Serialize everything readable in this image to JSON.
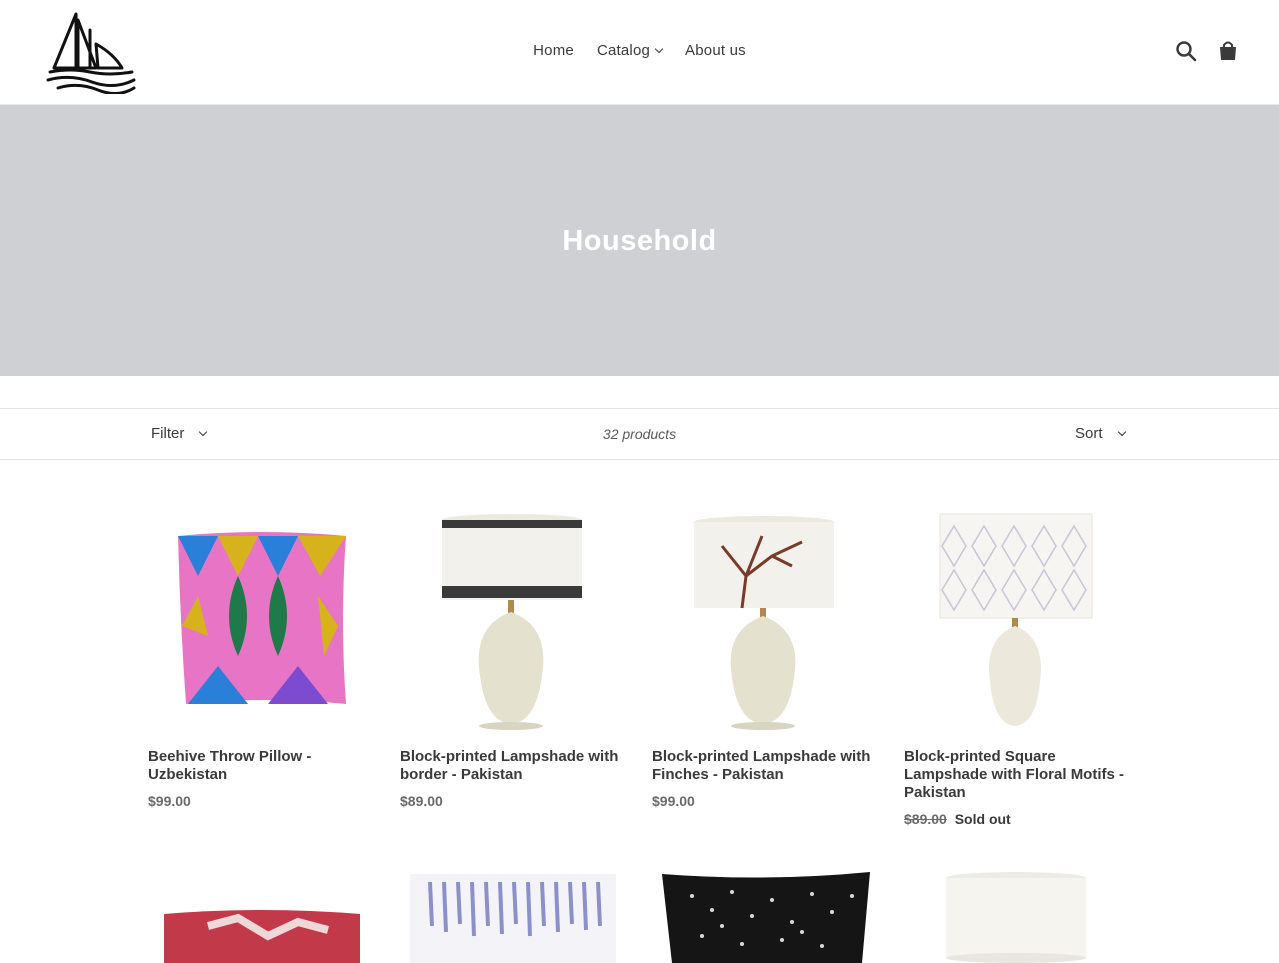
{
  "header": {
    "nav": [
      {
        "label": "Home"
      },
      {
        "label": "Catalog"
      },
      {
        "label": "About us"
      }
    ]
  },
  "hero": {
    "title": "Household"
  },
  "toolbar": {
    "filter_label": "Filter",
    "product_count": "32 products",
    "sort_label": "Sort"
  },
  "products": [
    {
      "title": "Beehive Throw Pillow - Uzbekistan",
      "price": "$99.00"
    },
    {
      "title": "Block-printed Lampshade with border - Pakistan",
      "price": "$89.00"
    },
    {
      "title": "Block-printed Lampshade with Finches - Pakistan",
      "price": "$99.00"
    },
    {
      "title": "Block-printed Square Lampshade with Floral Motifs - Pakistan",
      "price": "$89.00",
      "badge": "Sold out"
    }
  ],
  "colors": {
    "hero_bg": "#cfd0d3",
    "text": "#3a3a3a",
    "price": "#6a6a6a"
  }
}
